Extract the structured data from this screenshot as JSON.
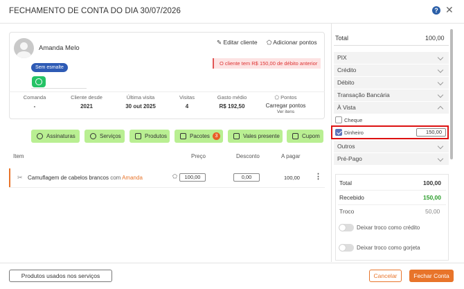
{
  "modal": {
    "title": "FECHAMENTO DE CONTA DO DIA 30/07/2026",
    "help": "?",
    "close": "✕"
  },
  "client": {
    "name": "Amanda Melo",
    "edit_label": "Editar cliente",
    "add_points_label": "Adicionar pontos",
    "debt_alert": "O cliente tem R$ 150,00 de débito anterior",
    "tag": "Sem esmalte",
    "stats": [
      {
        "label": "Comanda",
        "value": "-"
      },
      {
        "label": "Cliente desde",
        "value": "2021"
      },
      {
        "label": "Última visita",
        "value": "30 out 2025"
      },
      {
        "label": "Visitas",
        "value": "4"
      },
      {
        "label": "Gasto médio",
        "value": "R$ 192,50"
      },
      {
        "label": "Pontos",
        "value": "Carregar pontos",
        "sub": "Ver itens"
      }
    ]
  },
  "categories": [
    {
      "label": "Assinaturas"
    },
    {
      "label": "Serviços"
    },
    {
      "label": "Produtos"
    },
    {
      "label": "Pacotes",
      "count": "3"
    },
    {
      "label": "Vales presente"
    },
    {
      "label": "Cupom"
    }
  ],
  "table": {
    "headers": {
      "item": "Item",
      "price": "Preço",
      "discount": "Desconto",
      "to_pay": "A pagar"
    },
    "rows": [
      {
        "service": "Camuflagem de cabelos brancos",
        "with": "com",
        "professional": "Amanda",
        "price": "100,00",
        "discount": "0,00",
        "to_pay": "100,00"
      }
    ]
  },
  "payment": {
    "total_label": "Total",
    "total_value": "100,00",
    "methods": [
      "PIX",
      "Crédito",
      "Débito",
      "Transação Bancária",
      "À Vista",
      "Outros",
      "Pré-Pago"
    ],
    "sub_options": [
      {
        "label": "Cheque",
        "checked": false
      },
      {
        "label": "Dinheiro",
        "checked": true,
        "value": "150,00"
      }
    ]
  },
  "summary": {
    "total_label": "Total",
    "total_value": "100,00",
    "received_label": "Recebido",
    "received_value": "150,00",
    "change_label": "Troco",
    "change_value": "50,00",
    "toggle_credit": "Deixar troco como crédito",
    "toggle_tip": "Deixar troco como gorjeta"
  },
  "footer": {
    "products_button": "Produtos usados nos serviços",
    "cancel_button": "Cancelar",
    "close_button": "Fechar Conta"
  },
  "colors": {
    "accent": "#e8742a",
    "category_green": "#b9ef92",
    "alert_red": "#d33",
    "received_green": "#2a9d2a"
  }
}
